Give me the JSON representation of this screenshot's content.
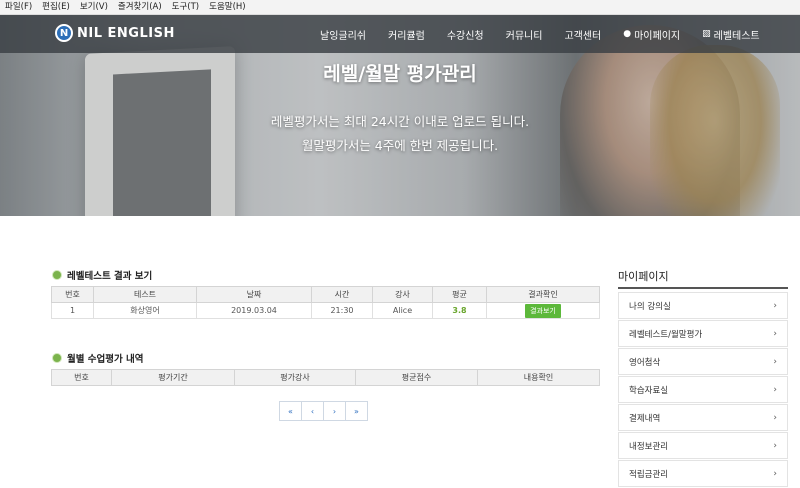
{
  "menubar": [
    "파일(F)",
    "편집(E)",
    "보기(V)",
    "즐겨찾기(A)",
    "도구(T)",
    "도움말(H)"
  ],
  "brand": {
    "logo_letter": "N",
    "name": "NIL ENGLISH"
  },
  "nav": {
    "items": [
      "날잉글리쉬",
      "커리큘럼",
      "수강신청",
      "커뮤니티",
      "고객센터"
    ],
    "mypage": "마이페이지",
    "leveltest": "레벨테스트"
  },
  "hero": {
    "title": "레벨/월말 평가관리",
    "line1": "레벨평가서는 최대 24시간 이내로 업로드 됩니다.",
    "line2": "월말평가서는 4주에 한번 제공됩니다."
  },
  "level_section": {
    "title": "레벨테스트 결과 보기",
    "headers": [
      "번호",
      "테스트",
      "날짜",
      "시간",
      "강사",
      "평균",
      "결과확인"
    ],
    "rows": [
      {
        "no": "1",
        "test": "화상영어",
        "date": "2019.03.04",
        "time": "21:30",
        "teacher": "Alice",
        "avg": "3.8",
        "action": "결과보기"
      }
    ]
  },
  "monthly_section": {
    "title": "월별 수업평가 내역",
    "headers": [
      "번호",
      "평가기간",
      "평가강사",
      "평균점수",
      "내용확인"
    ]
  },
  "pager": [
    "«",
    "‹",
    "›",
    "»"
  ],
  "sidebar": {
    "title": "마이페이지",
    "items": [
      "나의 강의실",
      "레벨테스트/월말평가",
      "영어첨삭",
      "학습자료실",
      "결제내역",
      "내정보관리",
      "적립금관리"
    ]
  },
  "colors": {
    "accent_green": "#5cb83a",
    "nav_bg": "#3a3f44",
    "pager_blue": "#2f6fbf"
  },
  "icons": {
    "mypage": "user-icon",
    "leveltest": "bar-chart-icon",
    "chevron": "chevron-right-icon"
  }
}
